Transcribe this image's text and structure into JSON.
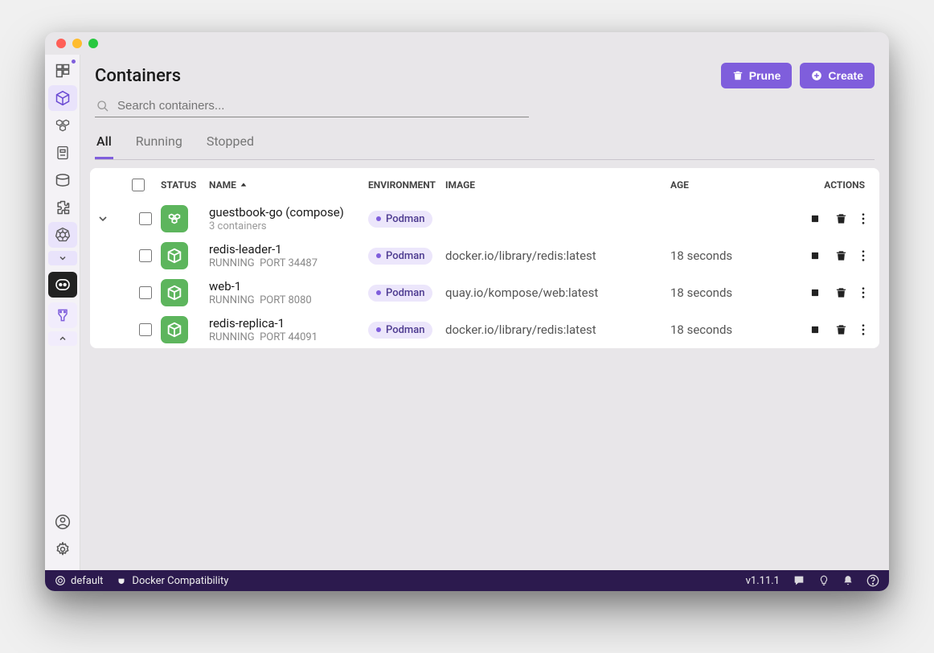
{
  "page": {
    "title": "Containers"
  },
  "buttons": {
    "prune": "Prune",
    "create": "Create"
  },
  "search": {
    "placeholder": "Search containers..."
  },
  "tabs": {
    "all": "All",
    "running": "Running",
    "stopped": "Stopped"
  },
  "columns": {
    "status": "STATUS",
    "name": "NAME",
    "environment": "ENVIRONMENT",
    "image": "IMAGE",
    "age": "AGE",
    "actions": "ACTIONS"
  },
  "rows": [
    {
      "name": "guestbook-go (compose)",
      "subtitle": "3 containers",
      "env": "Podman",
      "image": "",
      "age": "",
      "kind": "compose",
      "expandable": true
    },
    {
      "name": "redis-leader-1",
      "running": "RUNNING",
      "port_label": "PORT 34487",
      "env": "Podman",
      "image": "docker.io/library/redis:latest",
      "age": "18 seconds",
      "kind": "container"
    },
    {
      "name": "web-1",
      "running": "RUNNING",
      "port_label": "PORT 8080",
      "env": "Podman",
      "image": "quay.io/kompose/web:latest",
      "age": "18 seconds",
      "kind": "container"
    },
    {
      "name": "redis-replica-1",
      "running": "RUNNING",
      "port_label": "PORT 44091",
      "env": "Podman",
      "image": "docker.io/library/redis:latest",
      "age": "18 seconds",
      "kind": "container"
    }
  ],
  "footer": {
    "context": "default",
    "compat": "Docker Compatibility",
    "version": "v1.11.1"
  }
}
